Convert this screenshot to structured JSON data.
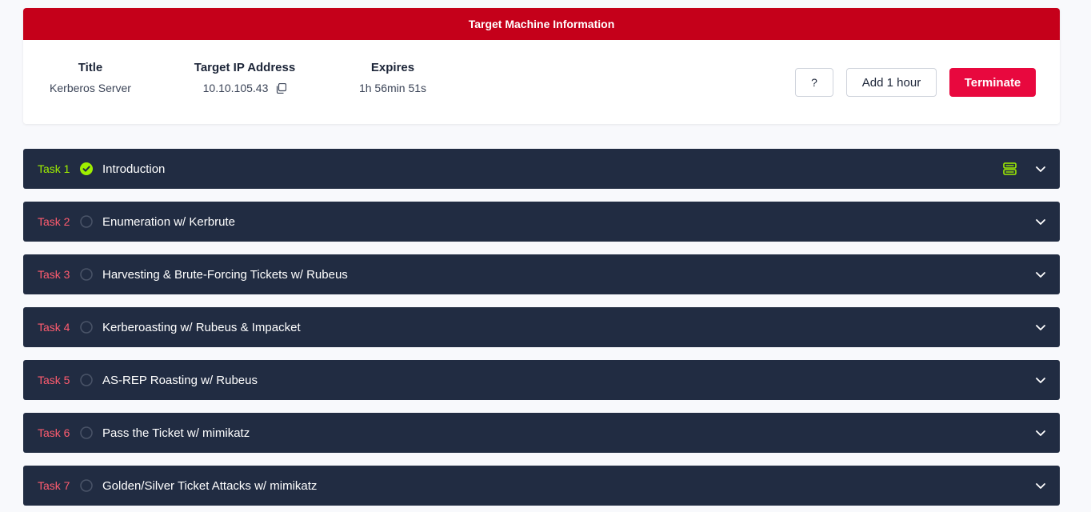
{
  "machine": {
    "header": "Target Machine Information",
    "title_label": "Title",
    "title_value": "Kerberos Server",
    "ip_label": "Target IP Address",
    "ip_value": "10.10.105.43",
    "expires_label": "Expires",
    "expires_value": "1h 56min 51s",
    "help_label": "?",
    "add_label": "Add 1 hour",
    "terminate_label": "Terminate"
  },
  "colors": {
    "header_red": "#c5001a",
    "terminate_red": "#e8083e",
    "task_bg": "#212c42",
    "done_green": "#9fef00",
    "todo_red": "#ff5c6f"
  },
  "tasks": [
    {
      "num": "Task 1",
      "title": "Introduction",
      "completed": true,
      "icon": "check-circle-icon"
    },
    {
      "num": "Task 2",
      "title": "Enumeration w/ Kerbrute",
      "completed": false,
      "icon": "empty-circle-icon"
    },
    {
      "num": "Task 3",
      "title": "Harvesting & Brute-Forcing Tickets w/ Rubeus",
      "completed": false,
      "icon": "empty-circle-icon"
    },
    {
      "num": "Task 4",
      "title": "Kerberoasting w/ Rubeus & Impacket",
      "completed": false,
      "icon": "empty-circle-icon"
    },
    {
      "num": "Task 5",
      "title": "AS-REP Roasting w/ Rubeus",
      "completed": false,
      "icon": "empty-circle-icon"
    },
    {
      "num": "Task 6",
      "title": "Pass the Ticket w/ mimikatz",
      "completed": false,
      "icon": "empty-circle-icon"
    },
    {
      "num": "Task 7",
      "title": "Golden/Silver Ticket Attacks w/ mimikatz",
      "completed": false,
      "icon": "empty-circle-icon"
    }
  ]
}
